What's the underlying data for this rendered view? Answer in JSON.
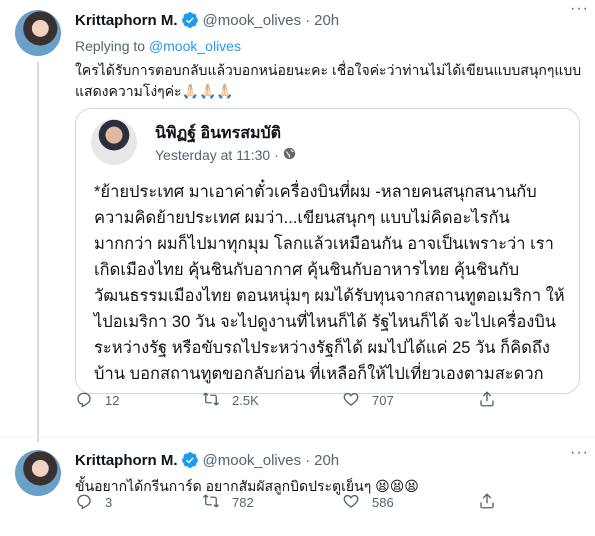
{
  "tweet1": {
    "name": "Krittaphorn M.",
    "handle": "@mook_olives",
    "dot": "·",
    "time": "20h",
    "replying_prefix": "Replying to",
    "replying_to": "@mook_olives",
    "text": "ใครได้รับการตอบกลับแล้วบอกหน่อยนะคะ เชื่อใจค่ะว่าท่านไม่ได้เขียนแบบสนุกๆแบบแสดงความโง่ๆค่ะ🙏🏻🙏🏻🙏🏻",
    "quote": {
      "name": "นิพิฏฐ์ อินทรสมบัติ",
      "time": "Yesterday at 11:30 ·",
      "body": "*ย้ายประเทศ มาเอาค่าตั๋วเครื่องบินที่ผม\n-หลายคนสนุกสนานกับความคิดย้ายประเทศ ผมว่า...เขียนสนุกๆ แบบไม่คิดอะไรกันมากกว่า  ผมก็ไปมาทุกมุม โลกแล้วเหมือนกัน  อาจเป็นเพราะว่า เราเกิดเมืองไทย คุ้นชินกับอากาศ คุ้นชินกับอาหารไทย  คุ้นชินกับวัฒนธรรมเมืองไทย ตอนหนุ่มๆ ผมได้รับทุนจากสถานทูตอเมริกา ให้ไปอเมริกา 30 วัน จะไปดูงานที่ไหนก็ได้ รัฐไหนก็ได้ จะไปเครื่องบินระหว่างรัฐ หรือขับรถไประหว่างรัฐก็ได้ ผมไปได้แค่ 25 วัน ก็คิดถึงบ้าน บอกสถานทูตขอกลับก่อน ที่เหลือก็ให้ไปเที่ยวเองตามสะดวก"
    },
    "actions": {
      "replies": "12",
      "retweets": "2.5K",
      "likes": "707"
    }
  },
  "tweet2": {
    "name": "Krittaphorn M.",
    "handle": "@mook_olives",
    "dot": "·",
    "time": "20h",
    "text": "ขั้นอยากได้กรีนการ์ด อยากสัมผัสลูกบิดประตูเย็นๆ 😫😫😫",
    "actions": {
      "replies": "3",
      "retweets": "782",
      "likes": "586"
    }
  },
  "icons": {
    "verified": "verified-badge-icon",
    "more": "more-options-icon",
    "globe": "globe-icon",
    "reply": "reply-icon",
    "retweet": "retweet-icon",
    "like": "heart-icon",
    "share": "share-icon"
  },
  "colors": {
    "accent": "#1d9bf0",
    "muted": "#536471",
    "border": "#cfd9de"
  }
}
